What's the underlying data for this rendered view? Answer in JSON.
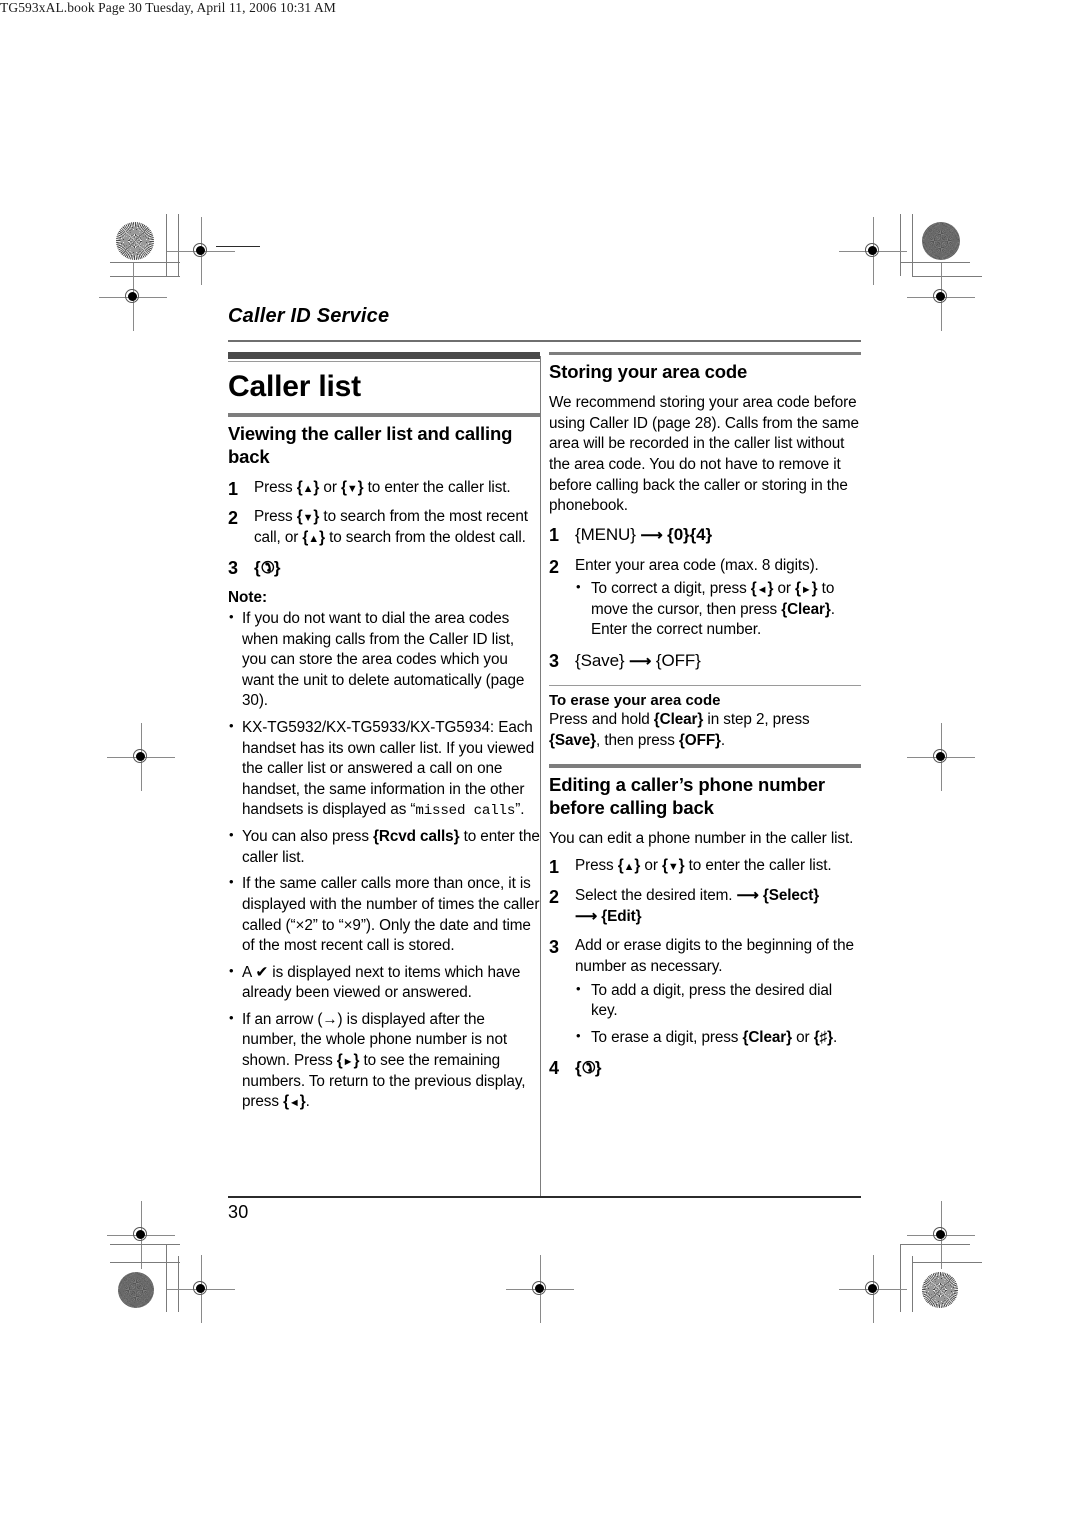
{
  "page": {
    "slug": "TG593xAL.book  Page 30  Tuesday, April 11, 2006  10:31 AM",
    "running_head": "Caller ID Service",
    "folio": "30"
  },
  "left_column": {
    "chapter_title": "Caller list",
    "section1": {
      "title": "Viewing the caller list and calling back",
      "steps": [
        {
          "num": "1",
          "text_a": "Press ",
          "key_a": "{▲}",
          "text_b": " or ",
          "key_b": "{▼}",
          "text_c": " to enter the caller list."
        },
        {
          "num": "2",
          "text_a": "Press ",
          "key_a": "{▼}",
          "text_b": " to search from the most recent call, or ",
          "key_b": "{▲}",
          "text_c": " to search from the oldest call."
        },
        {
          "num": "3",
          "key_only": "{✆}"
        }
      ]
    },
    "note_label": "Note:",
    "notes": [
      {
        "parts": [
          {
            "t": "If you do not want to dial the area codes when making calls from the Caller ID list, you can store the area codes which you want the unit to delete automatically (page 30)."
          }
        ]
      },
      {
        "parts": [
          {
            "t": "KX-TG5932/KX-TG5933/KX-TG5934: Each handset has its own caller list. If you viewed the caller list or answered a call on one handset, the same information in the other handsets is displayed as “"
          },
          {
            "t": "missed calls",
            "style": "mono"
          },
          {
            "t": "”."
          }
        ]
      },
      {
        "parts": [
          {
            "t": "You can also press "
          },
          {
            "t": "{Rcvd calls}",
            "style": "key"
          },
          {
            "t": " to enter the caller list."
          }
        ]
      },
      {
        "parts": [
          {
            "t": "If the same caller calls more than once, it is displayed with the number of times the caller called (“×2” to “×9”). Only the date and time of the most recent call is stored."
          }
        ]
      },
      {
        "parts": [
          {
            "t": "A ✔ is displayed next to items which have already been viewed or answered."
          }
        ]
      },
      {
        "parts": [
          {
            "t": "If an arrow (→) is displayed after the number, the whole phone number is not shown. Press "
          },
          {
            "t": "{►}",
            "style": "key"
          },
          {
            "t": " to see the remaining numbers. To return to the previous display, press "
          },
          {
            "t": "{◄}",
            "style": "key"
          },
          {
            "t": "."
          }
        ]
      }
    ]
  },
  "right_column": {
    "section2": {
      "title": "Storing your area code",
      "intro": "We recommend storing your area code before using Caller ID (page 28). Calls from the same area will be recorded in the caller list without the area code. You do not have to remove it before calling back the caller or storing in the phonebook.",
      "step1": {
        "num": "1",
        "keys": "{MENU} ⟶ {0}{4}"
      },
      "step2": {
        "num": "2",
        "text": "Enter your area code (max. 8 digits).",
        "bullet_parts": [
          {
            "t": "To correct a digit, press "
          },
          {
            "t": "{◄}",
            "style": "key"
          },
          {
            "t": " or "
          },
          {
            "t": "{►}",
            "style": "key"
          },
          {
            "t": " to move the cursor, then press "
          },
          {
            "t": "{Clear}",
            "style": "key"
          },
          {
            "t": ". Enter the correct number."
          }
        ]
      },
      "step3": {
        "num": "3",
        "keys": "{Save} ⟶ {OFF}"
      },
      "erase_title": "To erase your area code",
      "erase_parts": [
        {
          "t": "Press and hold "
        },
        {
          "t": "{Clear}",
          "style": "key"
        },
        {
          "t": " in step 2, press "
        },
        {
          "t": "{Save}",
          "style": "key"
        },
        {
          "t": ", then press "
        },
        {
          "t": "{OFF}",
          "style": "key"
        },
        {
          "t": "."
        }
      ]
    },
    "section3": {
      "title": "Editing a caller’s phone number before calling back",
      "intro": "You can edit a phone number in the caller list.",
      "step1_parts": [
        {
          "t": "Press "
        },
        {
          "t": "{▲}",
          "style": "key"
        },
        {
          "t": " or "
        },
        {
          "t": "{▼}",
          "style": "key"
        },
        {
          "t": " to enter the caller list."
        }
      ],
      "step2_parts": [
        {
          "t": "Select the desired item. "
        },
        {
          "t": "⟶ {Select} ⟶ {Edit}",
          "style": "key"
        }
      ],
      "step3_text": "Add or erase digits to the beginning of the number as necessary.",
      "step3_bullets": [
        {
          "parts": [
            {
              "t": "To add a digit, press the desired dial key."
            }
          ]
        },
        {
          "parts": [
            {
              "t": "To erase a digit, press "
            },
            {
              "t": "{Clear}",
              "style": "key"
            },
            {
              "t": " or "
            },
            {
              "t": "{♯}",
              "style": "key"
            },
            {
              "t": "."
            }
          ]
        }
      ],
      "step4_key": "{✆}"
    }
  }
}
